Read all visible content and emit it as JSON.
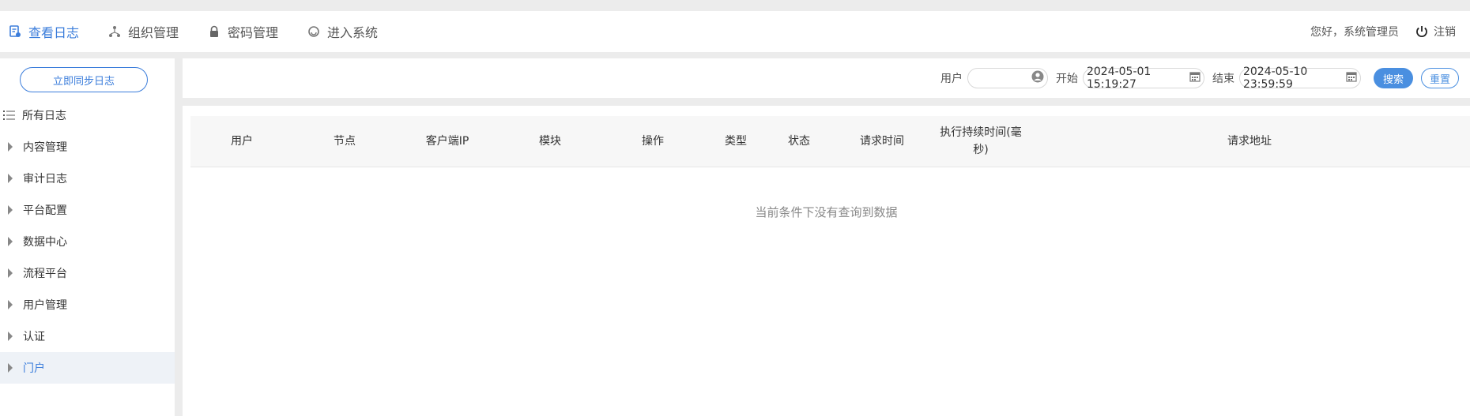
{
  "nav": {
    "items": [
      {
        "label": "查看日志",
        "icon": "log-icon",
        "active": true
      },
      {
        "label": "组织管理",
        "icon": "org-icon",
        "active": false
      },
      {
        "label": "密码管理",
        "icon": "lock-icon",
        "active": false
      },
      {
        "label": "进入系统",
        "icon": "system-icon",
        "active": false
      }
    ],
    "greeting": "您好，系统管理员",
    "logout_label": "注销"
  },
  "sidebar": {
    "sync_label": "立即同步日志",
    "items": [
      {
        "label": "所有日志"
      },
      {
        "label": "内容管理"
      },
      {
        "label": "审计日志"
      },
      {
        "label": "平台配置"
      },
      {
        "label": "数据中心"
      },
      {
        "label": "流程平台"
      },
      {
        "label": "用户管理"
      },
      {
        "label": "认证"
      },
      {
        "label": "门户"
      }
    ]
  },
  "filters": {
    "user_label": "用户",
    "start_label": "开始",
    "start_value": "2024-05-01 15:19:27",
    "end_label": "结束",
    "end_value": "2024-05-10 23:59:59",
    "search_label": "搜索",
    "reset_label": "重置"
  },
  "table": {
    "columns": [
      "用户",
      "节点",
      "客户端IP",
      "模块",
      "操作",
      "类型",
      "状态",
      "请求时间",
      "执行持续时间(毫秒)",
      "请求地址"
    ],
    "empty_text": "当前条件下没有查询到数据"
  },
  "colors": {
    "accent": "#3b7ddb",
    "primary_button": "#4a8fe0"
  }
}
